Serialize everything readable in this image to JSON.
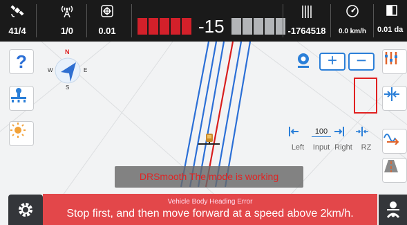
{
  "status_bar": {
    "satellites": {
      "icon": "satellite-icon",
      "value": "41/4"
    },
    "differential": {
      "icon": "antenna-icon",
      "value": "1/0"
    },
    "precision": {
      "icon": "crosshair-icon",
      "value": "0.01"
    },
    "offset": "-15",
    "signal_value": "-1764518",
    "speed": {
      "icon": "speedometer-icon",
      "value": "0.0 km/h"
    },
    "area": {
      "icon": "area-icon",
      "value": "0.01 da"
    }
  },
  "compass": {
    "north": "N",
    "south": "S",
    "west": "W",
    "east": "E"
  },
  "left_buttons": [
    {
      "icon": "help-icon",
      "label": "?"
    },
    {
      "icon": "tractor-implement-icon"
    },
    {
      "icon": "brightness-icon"
    }
  ],
  "right_buttons": [
    {
      "icon": "bars-settings-icon"
    },
    {
      "icon": "shift-line-icon"
    },
    {
      "icon": "wave-curve-icon"
    },
    {
      "icon": "road-view-icon"
    }
  ],
  "map_controls": {
    "zoom_in": "+",
    "zoom_out": "−"
  },
  "adjust_panel": {
    "left": "Left",
    "input_label": "Input",
    "input_value": "100",
    "right": "Right",
    "rz": "RZ"
  },
  "toast": "DRSmooth The mode is working",
  "banner": {
    "title": "Vehicle Body Heading Error",
    "message": "Stop first, and then move forward at a speed above 2km/h."
  },
  "colors": {
    "accent": "#2b7fd8",
    "alert": "#e3474a",
    "lightbar_active": "#d3202a"
  }
}
